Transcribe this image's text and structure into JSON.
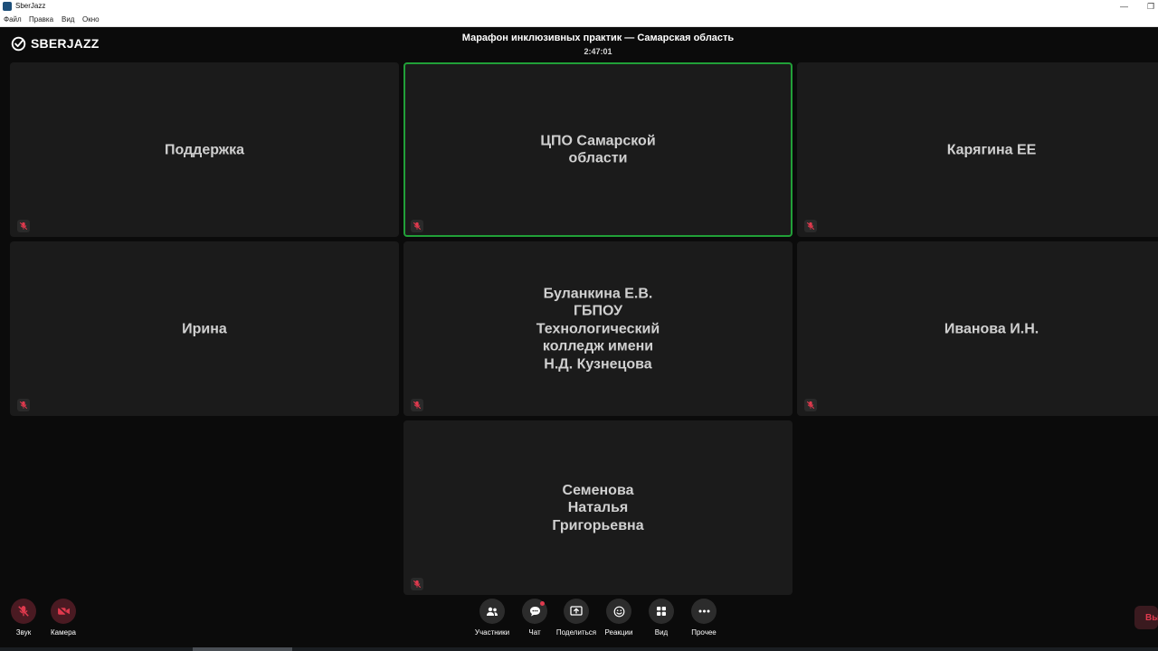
{
  "window": {
    "title": "SberJazz",
    "menu": [
      "Файл",
      "Правка",
      "Вид",
      "Окно"
    ]
  },
  "header": {
    "logo_text": "SBERJAZZ",
    "conference_title": "Марафон инклюзивных практик — Самарская область",
    "timer": "2:47:01"
  },
  "tiles": [
    {
      "name": "Поддержка",
      "active": false
    },
    {
      "name": "ЦПО Самарской\nобласти",
      "active": true
    },
    {
      "name": "Карягина ЕЕ",
      "active": false
    },
    {
      "name": "Ирина",
      "active": false
    },
    {
      "name": "Буланкина Е.В.\nГБПОУ\nТехнологический\nколледж имени\nН.Д. Кузнецова",
      "active": false
    },
    {
      "name": "Иванова И.Н.",
      "active": false
    },
    {
      "name": "Семенова\nНаталья\nГригорьевна",
      "active": false
    }
  ],
  "controls": {
    "sound": "Звук",
    "camera": "Камера",
    "participants": "Участники",
    "chat": "Чат",
    "share": "Поделиться",
    "reactions": "Реакции",
    "view": "Вид",
    "more": "Прочее",
    "leave": "Вы"
  },
  "colors": {
    "accent_green": "#21a038",
    "muted_red": "#e03a4e",
    "tile_bg": "#1b1b1b",
    "app_bg": "#0b0b0b"
  },
  "icons": {
    "mic_muted": "mic-off-icon",
    "camera_off": "camera-off-icon",
    "participants": "people-icon",
    "chat": "chat-bubble-icon",
    "share": "share-screen-icon",
    "reactions": "smile-icon",
    "view": "grid-icon",
    "more": "more-dots-icon"
  }
}
